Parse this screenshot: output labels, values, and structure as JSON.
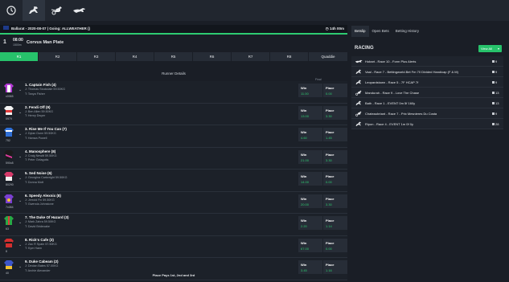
{
  "topbar": {
    "icons": [
      "clock-icon",
      "horse-racing-icon",
      "harness-racing-icon",
      "greyhound-icon"
    ]
  },
  "meeting": {
    "text": "Ballarat - 2020-08-07 | Going: ALLWEATHER ()",
    "countdown": "14h 00m"
  },
  "race": {
    "number": "1",
    "time": "08:00",
    "distance": "1500m",
    "name": "Corvus Man Plate",
    "progress": 1.0
  },
  "race_tabs": [
    "R1",
    "R2",
    "R3",
    "R4",
    "R5",
    "R6",
    "R7",
    "R8",
    "Quaddie"
  ],
  "runner_details_title": "Runner Details",
  "final_header": "Final",
  "runners": [
    {
      "name": "1. Captain Fish (4)",
      "jockey": "J: Thomas Stockdale 59.50KG",
      "trainer": "T: Tanya Fisher",
      "num": "x0065",
      "win": "11.00",
      "place": "0.00"
    },
    {
      "name": "2. Fendi Off (9)",
      "jockey": "J: Ben Allen 59.50KG",
      "trainer": "T: Henry Dwyer",
      "num": "0979",
      "win": "13.00",
      "place": "3.30"
    },
    {
      "name": "3. Rise Me If You Can (7)",
      "jockey": "J: Dylan Dunn 59.50KG",
      "trainer": "T: Hamza Powell",
      "num": "752",
      "win": "4.60",
      "place": "1.45"
    },
    {
      "name": "4. Manosphere (8)",
      "jockey": "J: Craig Newitt 59.50KG",
      "trainer": "T: Peter Gelagotis",
      "num": "590x8",
      "win": "21.00",
      "place": "3.30"
    },
    {
      "name": "5. Sed Noise (6)",
      "jockey": "J: Georgina Cartwright 59.50KG",
      "trainer": "T: Donna Mott",
      "num": "80290",
      "win": "14.00",
      "place": "0.00"
    },
    {
      "name": "6. Speedy Alexnix (8)",
      "jockey": "J: Jerrold Fix 59.50KG",
      "trainer": "T: Gwenda Johnstone",
      "num": "7x084",
      "win": "20.00",
      "place": "3.30"
    },
    {
      "name": "7. The Duke Of Hazard (3)",
      "jockey": "J: Mark Zahra 59.50KG",
      "trainer": "T: David Brideoake",
      "num": "63",
      "win": "2.20",
      "place": "1.14"
    },
    {
      "name": "8. Rick's Cafe (3)",
      "jockey": "J: Zac R Spain 57.50KG",
      "trainer": "T: Kym Hann",
      "num": "8",
      "win": "67.00",
      "place": "0.00"
    },
    {
      "name": "9. Duke Cabeam (2)",
      "jockey": "J: Declan Bates 57.00KG",
      "trainer": "T: Archie Alexander",
      "num": "40",
      "win": "3.45",
      "place": "1.16"
    }
  ],
  "labels": {
    "win": "Win",
    "place": "Place"
  },
  "place_pays": "Place Pays 1st, 2nd and 3rd",
  "right_tabs": [
    "Betslip",
    "Open Bets",
    "Betting History"
  ],
  "racing": {
    "title": "RACING",
    "view_all": "View All",
    "items": [
      {
        "label": "Hobart - Race 10 - Form Plus Alerts",
        "count": "9",
        "icon": "greyhound-icon"
      },
      {
        "label": "Vaal - Race 7 - Bettingworld.Bet Fm 70 Divided Handicap (F & M)",
        "count": "9",
        "icon": "horse-racing-icon"
      },
      {
        "label": "Leopardstown - Race 5 - 7F HCAP 7f",
        "count": "9",
        "icon": "horse-racing-icon"
      },
      {
        "label": "Mandurah - Race 9 - Love The Chase",
        "count": "13",
        "icon": "harness-racing-icon"
      },
      {
        "label": "Bath - Race 1 - EVENT 0m 5f 160y",
        "count": "13",
        "icon": "horse-racing-icon"
      },
      {
        "label": "Chateaubriant - Race 7 - Prix Mesnieres Du Costa",
        "count": "9",
        "icon": "harness-racing-icon"
      },
      {
        "label": "Ripon - Race 4 - EVENT 1m 0f 0y",
        "count": "28",
        "icon": "horse-racing-icon"
      }
    ]
  },
  "colors": {
    "accent": "#27c26b",
    "odds": "#2ecc71",
    "background": "#1a1e26",
    "panel": "#21262f"
  }
}
